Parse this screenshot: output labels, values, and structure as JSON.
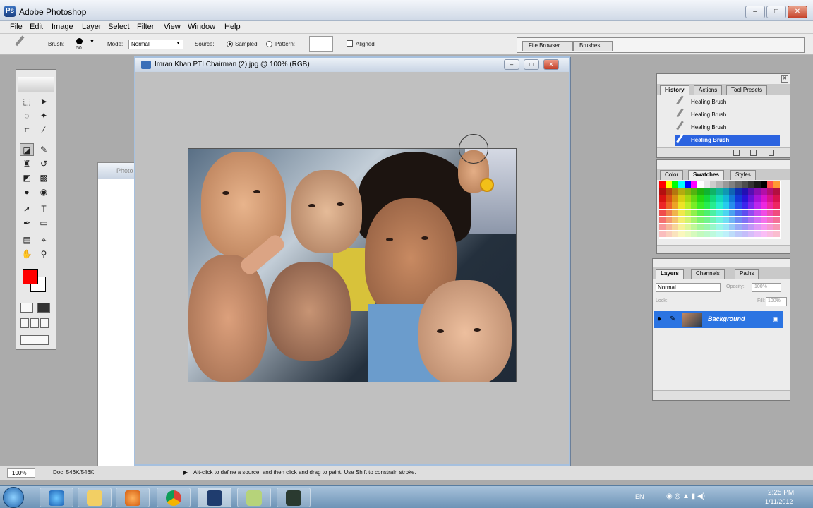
{
  "app": {
    "title": "Adobe Photoshop",
    "icon": "photoshop-icon"
  },
  "window_controls": {
    "minimize": "–",
    "maximize": "□",
    "close": "✕"
  },
  "menu": [
    "File",
    "Edit",
    "Image",
    "Layer",
    "Select",
    "Filter",
    "View",
    "Window",
    "Help"
  ],
  "options_bar": {
    "brush_label": "Brush:",
    "brush_size": "50",
    "mode_label": "Mode:",
    "mode_value": "Normal",
    "source_label": "Source:",
    "sampled_label": "Sampled",
    "pattern_label": "Pattern:",
    "aligned_label": "Aligned",
    "file_browser_tab": "File Browser",
    "brushes_tab": "Brushes"
  },
  "document": {
    "title": "Imran Khan PTI Chairman (2).jpg @ 100% (RGB)",
    "background_title": "Photo"
  },
  "history": {
    "tabs": [
      "History",
      "Actions",
      "Tool Presets"
    ],
    "items": [
      "Healing Brush",
      "Healing Brush",
      "Healing Brush",
      "Healing Brush"
    ],
    "selected_index": 3
  },
  "swatches": {
    "tabs": [
      "Color",
      "Swatches",
      "Styles"
    ],
    "colors": [
      "#ff0000",
      "#ffff00",
      "#00ff00",
      "#00ffff",
      "#0000ff",
      "#ff00ff",
      "#ffffff",
      "#e6e6e6",
      "#cccccc",
      "#b3b3b3",
      "#999999",
      "#808080",
      "#666666",
      "#4d4d4d",
      "#333333",
      "#1a1a1a",
      "#000000",
      "#ff4d4d",
      "#ff9933",
      "#ffe066",
      "#99ff66",
      "#33ffcc",
      "#3399ff",
      "#9966ff",
      "#ff66cc"
    ]
  },
  "layers": {
    "tabs": [
      "Layers",
      "Channels",
      "Paths"
    ],
    "blend_mode": "Normal",
    "opacity_label": "Opacity:",
    "opacity_value": "100%",
    "lock_label": "Lock:",
    "fill_label": "Fill:",
    "fill_value": "100%",
    "layer_name": "Background"
  },
  "status": {
    "zoom": "100%",
    "doc": "Doc: 546K/546K",
    "hint": "Alt-click to define a source, and then click and drag to paint. Use Shift to constrain stroke."
  },
  "taskbar": {
    "lang": "EN",
    "time": "2:25 PM",
    "date": "1/11/2012",
    "apps": [
      "internet-explorer-icon",
      "file-explorer-icon",
      "media-player-icon",
      "chrome-icon",
      "photoshop-task-icon",
      "notes-icon",
      "video-icon"
    ]
  }
}
